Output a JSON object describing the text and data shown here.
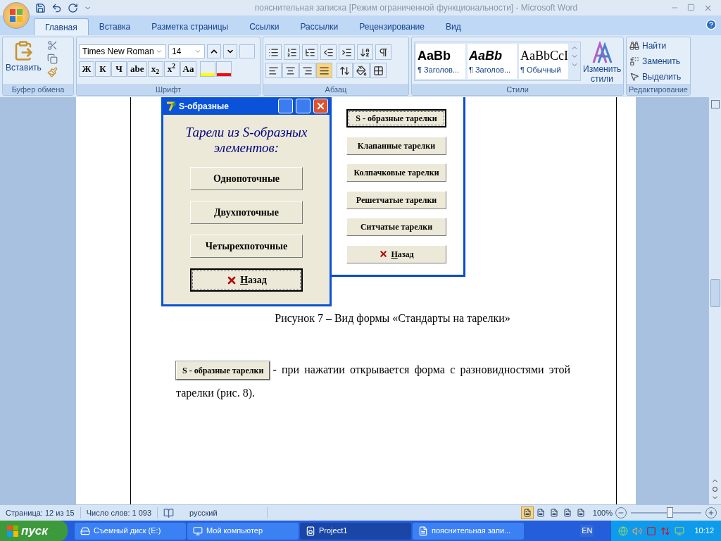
{
  "window": {
    "title": "пояснительная записка [Режим ограниченной функциональности] - Microsoft Word"
  },
  "tabs": [
    {
      "label": "Главная",
      "selected": true
    },
    {
      "label": "Вставка",
      "selected": false
    },
    {
      "label": "Разметка страницы",
      "selected": false
    },
    {
      "label": "Ссылки",
      "selected": false
    },
    {
      "label": "Рассылки",
      "selected": false
    },
    {
      "label": "Рецензирование",
      "selected": false
    },
    {
      "label": "Вид",
      "selected": false
    }
  ],
  "ribbon": {
    "clipboard": {
      "paste": "Вставить",
      "label": "Буфер обмена"
    },
    "font": {
      "name": "Times New Roman",
      "size": "14",
      "format_buttons": [
        "Ж",
        "К",
        "Ч",
        "abe",
        "x$_{2}$",
        "x$^{2}$",
        "Aa"
      ],
      "label": "Шрифт"
    },
    "paragraph": {
      "alignments": [
        {
          "selected": false
        },
        {
          "selected": false
        },
        {
          "selected": false
        },
        {
          "selected": true
        }
      ],
      "label": "Абзац"
    },
    "styles": {
      "items": [
        {
          "preview": "AaBb",
          "name": "¶ Заголов...",
          "kind": "heading1"
        },
        {
          "preview": "AaBb",
          "name": "¶ Заголов...",
          "kind": "heading2"
        },
        {
          "preview": "AaBbCcI",
          "name": "¶ Обычный",
          "kind": "normal"
        }
      ],
      "change_styles": "Изменить стили",
      "label": "Стили"
    },
    "editing": {
      "items": [
        "Найти",
        "Заменить",
        "Выделить"
      ],
      "label": "Редактирование"
    }
  },
  "document": {
    "dialog": {
      "title": "S-образные",
      "heading": "Тарели из S-образных элементов:",
      "buttons": [
        {
          "label": "Однопоточные",
          "selected": false
        },
        {
          "label": "Двухпоточные",
          "selected": false
        },
        {
          "label": "Четырехпоточные",
          "selected": false
        },
        {
          "label": "Назад",
          "selected": true,
          "kind": "back"
        }
      ]
    },
    "back_form": {
      "buttons": [
        {
          "label": "S - образные тарелки",
          "selected": true
        },
        {
          "label": "Клапанные тарелки",
          "selected": false
        },
        {
          "label": "Колпачковые тарелки",
          "selected": false
        },
        {
          "label": "Решетчатые тарелки",
          "selected": false
        },
        {
          "label": "Ситчатые тарелки",
          "selected": false
        },
        {
          "label": "Назад",
          "selected": false,
          "kind": "back"
        }
      ]
    },
    "caption": "Рисунок 7 – Вид формы «Стандарты на тарелки»",
    "inline_button": "S - образные тарелки",
    "paragraph_end": "- при нажатии открывается форма с разновидностями этой тарелки (рис. 8)."
  },
  "status_bar": {
    "page": "Страница: 12 из 15",
    "words": "Число слов: 1 093",
    "language": "русский",
    "views": [
      {
        "selected": true
      },
      {
        "selected": false
      },
      {
        "selected": false
      },
      {
        "selected": false
      },
      {
        "selected": false
      }
    ],
    "zoom": "100%",
    "zoom_slider": {
      "level": 0.56
    }
  },
  "taskbar": {
    "start": "пуск",
    "items": [
      {
        "label": "Съемный диск (E:)",
        "selected": false,
        "kind": "drive"
      },
      {
        "label": "Мой компьютер",
        "selected": false,
        "kind": "computer"
      },
      {
        "label": "Project1",
        "selected": true,
        "kind": "delphi"
      },
      {
        "label": "пояснительная запи...",
        "selected": false,
        "kind": "word"
      }
    ],
    "language": "EN",
    "clock": "10:12"
  }
}
